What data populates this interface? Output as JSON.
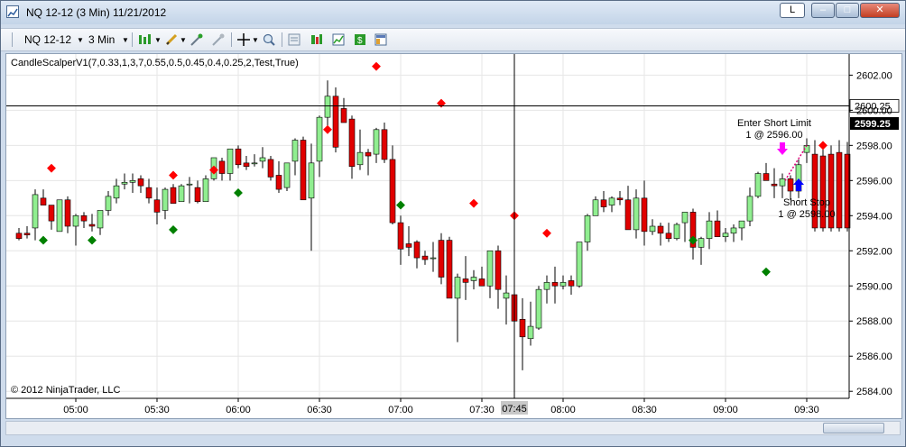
{
  "window": {
    "title": "NQ 12-12 (3 Min)  11/21/2012",
    "link_button_label": "L",
    "minimize_label": "–",
    "maximize_label": "□",
    "close_label": "✕"
  },
  "toolbar": {
    "instrument": "NQ 12-12",
    "interval": "3 Min",
    "icons": [
      "bar-style-icon",
      "drawing-pencil-icon",
      "add-indicator-icon",
      "strategy-icon",
      "crosshair-icon",
      "zoom-icon",
      "data-box-icon",
      "properties-icon",
      "chart-trader-icon",
      "dollar-icon",
      "layout-icon"
    ]
  },
  "chart": {
    "indicator_label": "CandleScalperV1(7,0.33,1,3,7,0.55,0.5,0.45,0.4,0.25,2,Test,True)",
    "copyright": "© 2012 NinjaTrader, LLC",
    "price_levels": [
      "2602.00",
      "2600.00",
      "2598.00",
      "2596.00",
      "2594.00",
      "2592.00",
      "2590.00",
      "2588.00",
      "2586.00",
      "2584.00"
    ],
    "current_price_label": "2599.25",
    "hline_price_label": "2600.25",
    "crosshair_time_label": "07:45",
    "time_labels": [
      "05:00",
      "05:30",
      "06:00",
      "06:30",
      "07:00",
      "07:30",
      "08:00",
      "08:30",
      "09:00",
      "09:30"
    ],
    "order_enter": {
      "title": "Enter Short Limit",
      "detail": "1 @ 2596.00"
    },
    "order_stop": {
      "title": "Short Stop",
      "detail": "1 @ 2598.00"
    },
    "colors": {
      "up": "#90ee90",
      "down": "#e00000",
      "up_marker": "#008000",
      "down_marker": "#ff0000",
      "grid": "#e6e6e6"
    }
  },
  "chart_data": {
    "type": "candlestick",
    "y_range": [
      2583.6,
      2603.2
    ],
    "candles": [
      [
        2593.0,
        2593.3,
        2592.6,
        2592.7
      ],
      [
        2593.0,
        2593.4,
        2592.7,
        2592.9
      ],
      [
        2593.3,
        2595.5,
        2592.6,
        2595.2
      ],
      [
        2595.0,
        2595.5,
        2594.6,
        2594.6
      ],
      [
        2594.6,
        2594.6,
        2593.2,
        2593.7
      ],
      [
        2593.1,
        2594.9,
        2593.1,
        2594.9
      ],
      [
        2594.9,
        2595.1,
        2593.0,
        2593.4
      ],
      [
        2593.4,
        2594.1,
        2592.3,
        2594.0
      ],
      [
        2594.0,
        2594.2,
        2593.3,
        2593.7
      ],
      [
        2593.5,
        2594.1,
        2593.1,
        2593.4
      ],
      [
        2593.3,
        2594.1,
        2592.9,
        2594.3
      ],
      [
        2594.3,
        2595.4,
        2594.0,
        2595.1
      ],
      [
        2595.0,
        2596.1,
        2594.7,
        2595.7
      ],
      [
        2595.8,
        2596.4,
        2595.5,
        2595.9
      ],
      [
        2595.9,
        2596.4,
        2595.3,
        2596.0
      ],
      [
        2596.1,
        2596.3,
        2595.3,
        2595.7
      ],
      [
        2595.6,
        2596.1,
        2594.7,
        2595.0
      ],
      [
        2594.9,
        2595.6,
        2593.5,
        2594.2
      ],
      [
        2594.3,
        2595.6,
        2593.8,
        2595.5
      ],
      [
        2595.6,
        2595.8,
        2594.7,
        2594.7
      ],
      [
        2594.8,
        2595.8,
        2594.8,
        2595.7
      ],
      [
        2595.8,
        2596.2,
        2594.7,
        2595.8
      ],
      [
        2595.6,
        2596.0,
        2594.7,
        2594.8
      ],
      [
        2594.8,
        2596.3,
        2594.8,
        2596.1
      ],
      [
        2596.1,
        2597.3,
        2596.0,
        2597.3
      ],
      [
        2597.1,
        2597.3,
        2596.0,
        2596.4
      ],
      [
        2596.4,
        2597.8,
        2596.0,
        2597.8
      ],
      [
        2597.8,
        2598.0,
        2596.7,
        2596.9
      ],
      [
        2597.0,
        2597.4,
        2596.6,
        2596.8
      ],
      [
        2597.0,
        2597.5,
        2596.8,
        2597.0
      ],
      [
        2597.1,
        2597.9,
        2596.7,
        2597.3
      ],
      [
        2597.2,
        2597.4,
        2596.0,
        2596.2
      ],
      [
        2596.3,
        2597.1,
        2595.3,
        2595.5
      ],
      [
        2595.6,
        2597.0,
        2595.4,
        2597.0
      ],
      [
        2597.1,
        2598.4,
        2596.3,
        2598.3
      ],
      [
        2598.3,
        2598.5,
        2595.5,
        2594.9
      ],
      [
        2595.0,
        2598.1,
        2592.0,
        2597.0
      ],
      [
        2597.1,
        2599.7,
        2596.2,
        2599.6
      ],
      [
        2599.6,
        2601.7,
        2599.0,
        2600.8
      ],
      [
        2600.8,
        2601.3,
        2597.6,
        2597.9
      ],
      [
        2600.1,
        2600.7,
        2599.7,
        2599.3
      ],
      [
        2599.5,
        2599.7,
        2596.1,
        2596.8
      ],
      [
        2596.9,
        2598.9,
        2596.6,
        2597.6
      ],
      [
        2597.6,
        2597.8,
        2596.3,
        2597.4
      ],
      [
        2597.5,
        2599.0,
        2597.0,
        2598.9
      ],
      [
        2598.9,
        2599.3,
        2597.0,
        2597.2
      ],
      [
        2597.2,
        2598.0,
        2593.5,
        2593.6
      ],
      [
        2593.6,
        2594.0,
        2591.2,
        2592.1
      ],
      [
        2592.4,
        2593.4,
        2591.7,
        2592.2
      ],
      [
        2592.5,
        2592.6,
        2591.0,
        2591.6
      ],
      [
        2591.7,
        2592.0,
        2591.2,
        2591.5
      ],
      [
        2591.6,
        2592.5,
        2590.8,
        2591.6
      ],
      [
        2592.6,
        2593.0,
        2590.1,
        2590.5
      ],
      [
        2592.6,
        2592.8,
        2589.5,
        2589.3
      ],
      [
        2589.3,
        2590.7,
        2586.8,
        2590.5
      ],
      [
        2590.4,
        2591.7,
        2589.2,
        2590.2
      ],
      [
        2590.3,
        2590.9,
        2589.8,
        2590.5
      ],
      [
        2590.4,
        2591.1,
        2590.0,
        2590.0
      ],
      [
        2590.0,
        2592.0,
        2589.3,
        2592.0
      ],
      [
        2592.0,
        2592.3,
        2588.7,
        2589.8
      ],
      [
        2589.3,
        2590.6,
        2587.8,
        2589.6
      ],
      [
        2589.5,
        2589.8,
        2586.5,
        2588.0
      ],
      [
        2588.1,
        2589.3,
        2585.2,
        2587.1
      ],
      [
        2587.0,
        2589.1,
        2586.6,
        2587.7
      ],
      [
        2587.6,
        2590.0,
        2587.5,
        2589.8
      ],
      [
        2589.8,
        2590.6,
        2589.0,
        2590.2
      ],
      [
        2590.2,
        2591.1,
        2589.0,
        2590.0
      ],
      [
        2590.0,
        2590.6,
        2589.8,
        2590.2
      ],
      [
        2590.3,
        2590.6,
        2589.5,
        2590.0
      ],
      [
        2590.0,
        2592.5,
        2589.9,
        2592.5
      ],
      [
        2592.5,
        2594.1,
        2592.0,
        2594.0
      ],
      [
        2594.0,
        2595.1,
        2594.1,
        2594.9
      ],
      [
        2594.9,
        2595.4,
        2594.2,
        2594.5
      ],
      [
        2594.6,
        2595.1,
        2594.2,
        2595.0
      ],
      [
        2595.0,
        2595.4,
        2594.6,
        2594.9
      ],
      [
        2594.9,
        2595.7,
        2593.7,
        2593.2
      ],
      [
        2593.2,
        2595.5,
        2592.7,
        2595.0
      ],
      [
        2595.0,
        2596.0,
        2592.3,
        2593.1
      ],
      [
        2593.1,
        2593.8,
        2592.9,
        2593.4
      ],
      [
        2593.4,
        2593.6,
        2592.3,
        2593.0
      ],
      [
        2593.0,
        2593.6,
        2592.5,
        2592.7
      ],
      [
        2592.7,
        2593.6,
        2592.6,
        2593.5
      ],
      [
        2593.6,
        2594.0,
        2592.5,
        2594.2
      ],
      [
        2594.2,
        2594.4,
        2591.5,
        2592.2
      ],
      [
        2592.2,
        2592.8,
        2591.2,
        2592.7
      ],
      [
        2592.7,
        2594.2,
        2592.1,
        2593.7
      ],
      [
        2593.7,
        2594.3,
        2593.2,
        2592.8
      ],
      [
        2592.8,
        2593.3,
        2592.5,
        2593.0
      ],
      [
        2593.0,
        2593.5,
        2592.5,
        2593.3
      ],
      [
        2593.3,
        2593.7,
        2592.6,
        2593.7
      ],
      [
        2593.7,
        2595.6,
        2593.4,
        2595.1
      ],
      [
        2595.1,
        2596.5,
        2595.0,
        2596.4
      ],
      [
        2596.4,
        2597.0,
        2596.1,
        2596.0
      ],
      [
        2595.8,
        2596.7,
        2595.0,
        2595.7
      ],
      [
        2595.7,
        2596.4,
        2595.0,
        2596.1
      ],
      [
        2596.1,
        2596.3,
        2594.9,
        2595.4
      ],
      [
        2595.4,
        2597.2,
        2595.0,
        2596.9
      ],
      [
        2597.6,
        2598.4,
        2597.0,
        2598.0
      ],
      [
        2597.5,
        2598.3,
        2593.1,
        2593.3
      ],
      [
        2597.4,
        2598.0,
        2593.1,
        2593.3
      ],
      [
        2597.5,
        2598.0,
        2593.1,
        2593.3
      ],
      [
        2597.6,
        2598.3,
        2593.1,
        2593.3
      ],
      [
        2597.5,
        2598.2,
        2593.1,
        2593.3
      ]
    ],
    "up_markers": [
      {
        "index": 3,
        "price": 2592.6
      },
      {
        "index": 9,
        "price": 2592.6
      },
      {
        "index": 19,
        "price": 2593.2
      },
      {
        "index": 27,
        "price": 2595.3
      },
      {
        "index": 47,
        "price": 2594.6
      },
      {
        "index": 83,
        "price": 2592.6
      },
      {
        "index": 92,
        "price": 2590.8
      }
    ],
    "down_markers": [
      {
        "index": 4,
        "price": 2596.7
      },
      {
        "index": 19,
        "price": 2596.3
      },
      {
        "index": 24,
        "price": 2596.6
      },
      {
        "index": 38,
        "price": 2598.9
      },
      {
        "index": 44,
        "price": 2602.5
      },
      {
        "index": 52,
        "price": 2600.4
      },
      {
        "index": 56,
        "price": 2594.7
      },
      {
        "index": 61,
        "price": 2594.0
      },
      {
        "index": 65,
        "price": 2593.0
      },
      {
        "index": 99,
        "price": 2598.0
      }
    ],
    "time_label_indices": [
      7,
      17,
      27,
      37,
      47,
      57,
      67,
      77,
      87,
      97
    ],
    "crosshair_index": 61,
    "hline_price": 2600.25
  }
}
